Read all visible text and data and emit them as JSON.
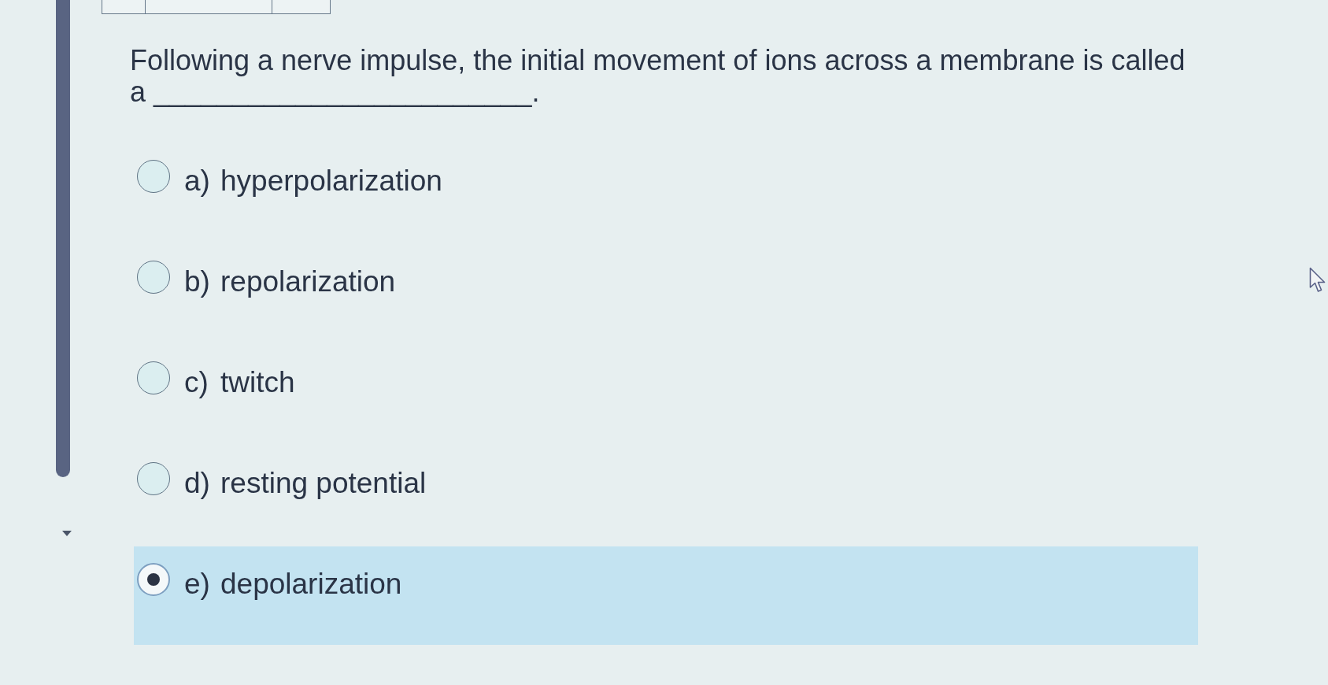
{
  "question": {
    "text": "Following a nerve impulse, the initial movement of ions across a membrane is called a ________________________."
  },
  "options": [
    {
      "letter": "a)",
      "label": "hyperpolarization",
      "selected": false
    },
    {
      "letter": "b)",
      "label": "repolarization",
      "selected": false
    },
    {
      "letter": "c)",
      "label": "twitch",
      "selected": false
    },
    {
      "letter": "d)",
      "label": "resting potential",
      "selected": false
    },
    {
      "letter": "e)",
      "label": "depolarization",
      "selected": true
    }
  ]
}
